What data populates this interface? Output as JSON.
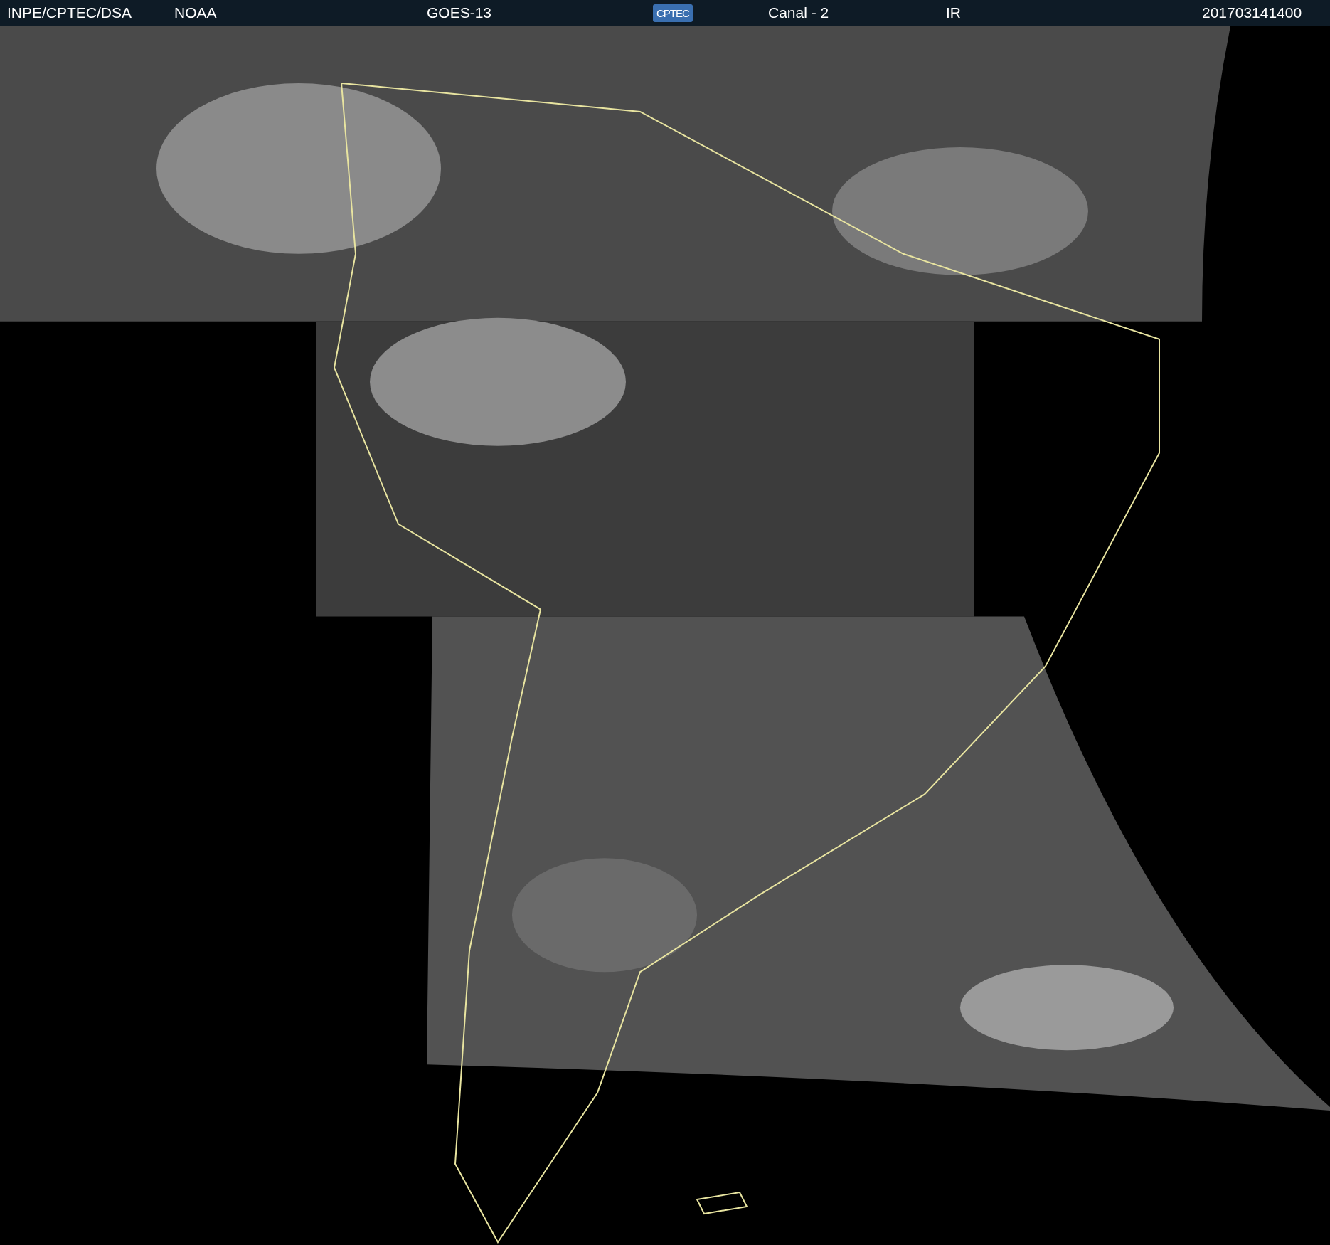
{
  "header": {
    "source": "INPE/CPTEC/DSA",
    "agency": "NOAA",
    "satellite": "GOES-13",
    "logo": "CPTEC",
    "channel": "Canal - 2",
    "band": "IR",
    "timestamp": "201703141400"
  }
}
